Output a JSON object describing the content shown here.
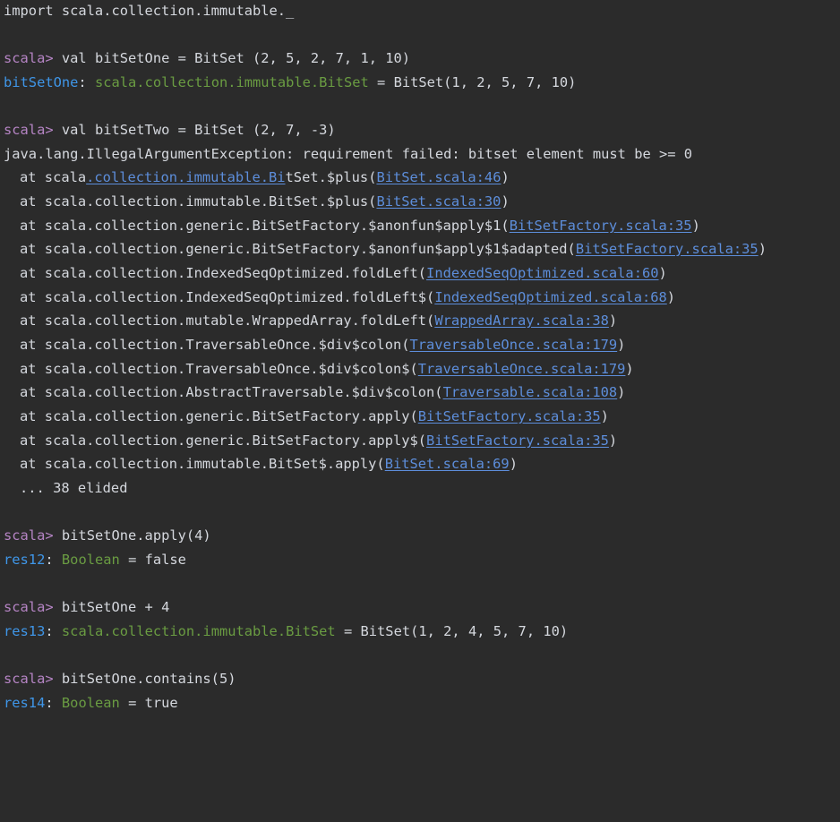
{
  "console": {
    "import_line": "import scala.collection.immutable._",
    "prompt": "scala>",
    "cmd1": "val bitSetOne = BitSet (2, 5, 2, 7, 1, 10)",
    "res1": {
      "name": "bitSetOne",
      "colon": ":",
      "type": "scala.collection.immutable.BitSet",
      "value": "= BitSet(1, 2, 5, 7, 10)"
    },
    "cmd2": "val bitSetTwo = BitSet (2, 7, -3)",
    "exception": "java.lang.IllegalArgumentException: requirement failed: bitset element must be >= 0",
    "stack": [
      {
        "at": "at scala",
        "link_prefix": ".collection.immutable.Bi",
        "mid": "tSet.$plus(",
        "file": "BitSet.scala:46",
        "close": ")"
      },
      {
        "at": "at scala.collection.immutable.BitSet.$plus(",
        "file": "BitSet.scala:30",
        "close": ")"
      },
      {
        "at": "at scala.collection.generic.BitSetFactory.$anonfun$apply$1(",
        "file": "BitSetFactory.scala:35",
        "close": ")"
      },
      {
        "at": "at scala.collection.generic.BitSetFactory.$anonfun$apply$1$adapted(",
        "file": "BitSetFactory.scala:35",
        "close": ")"
      },
      {
        "at": "at scala.collection.IndexedSeqOptimized.foldLeft(",
        "file": "IndexedSeqOptimized.scala:60",
        "close": ")"
      },
      {
        "at": "at scala.collection.IndexedSeqOptimized.foldLeft$(",
        "file": "IndexedSeqOptimized.scala:68",
        "close": ")"
      },
      {
        "at": "at scala.collection.mutable.WrappedArray.foldLeft(",
        "file": "WrappedArray.scala:38",
        "close": ")"
      },
      {
        "at": "at scala.collection.TraversableOnce.$div$colon(",
        "file": "TraversableOnce.scala:179",
        "close": ")"
      },
      {
        "at": "at scala.collection.TraversableOnce.$div$colon$(",
        "file": "TraversableOnce.scala:179",
        "close": ")"
      },
      {
        "at": "at scala.collection.AbstractTraversable.$div$colon(",
        "file": "Traversable.scala:108",
        "close": ")"
      },
      {
        "at": "at scala.collection.generic.BitSetFactory.apply(",
        "file": "BitSetFactory.scala:35",
        "close": ")"
      },
      {
        "at": "at scala.collection.generic.BitSetFactory.apply$(",
        "file": "BitSetFactory.scala:35",
        "close": ")"
      },
      {
        "at": "at scala.collection.immutable.BitSet$.apply(",
        "file": "BitSet.scala:69",
        "close": ")"
      }
    ],
    "elided": "... 38 elided",
    "cmd3": "bitSetOne.apply(4)",
    "res2": {
      "name": "res12",
      "colon": ":",
      "type": "Boolean",
      "value": "= false"
    },
    "cmd4": "bitSetOne + 4",
    "res3": {
      "name": "res13",
      "colon": ":",
      "type": "scala.collection.immutable.BitSet",
      "value": "= BitSet(1, 2, 4, 5, 7, 10)"
    },
    "cmd5": "bitSetOne.contains(5)",
    "res4": {
      "name": "res14",
      "colon": ":",
      "type": "Boolean",
      "value": "= true"
    }
  },
  "colors": {
    "background": "#2b2b2b",
    "text": "#d5d8de",
    "prompt": "#b584c4",
    "variable": "#3f96e8",
    "type": "#6a9c42",
    "link": "#5d8edb"
  }
}
